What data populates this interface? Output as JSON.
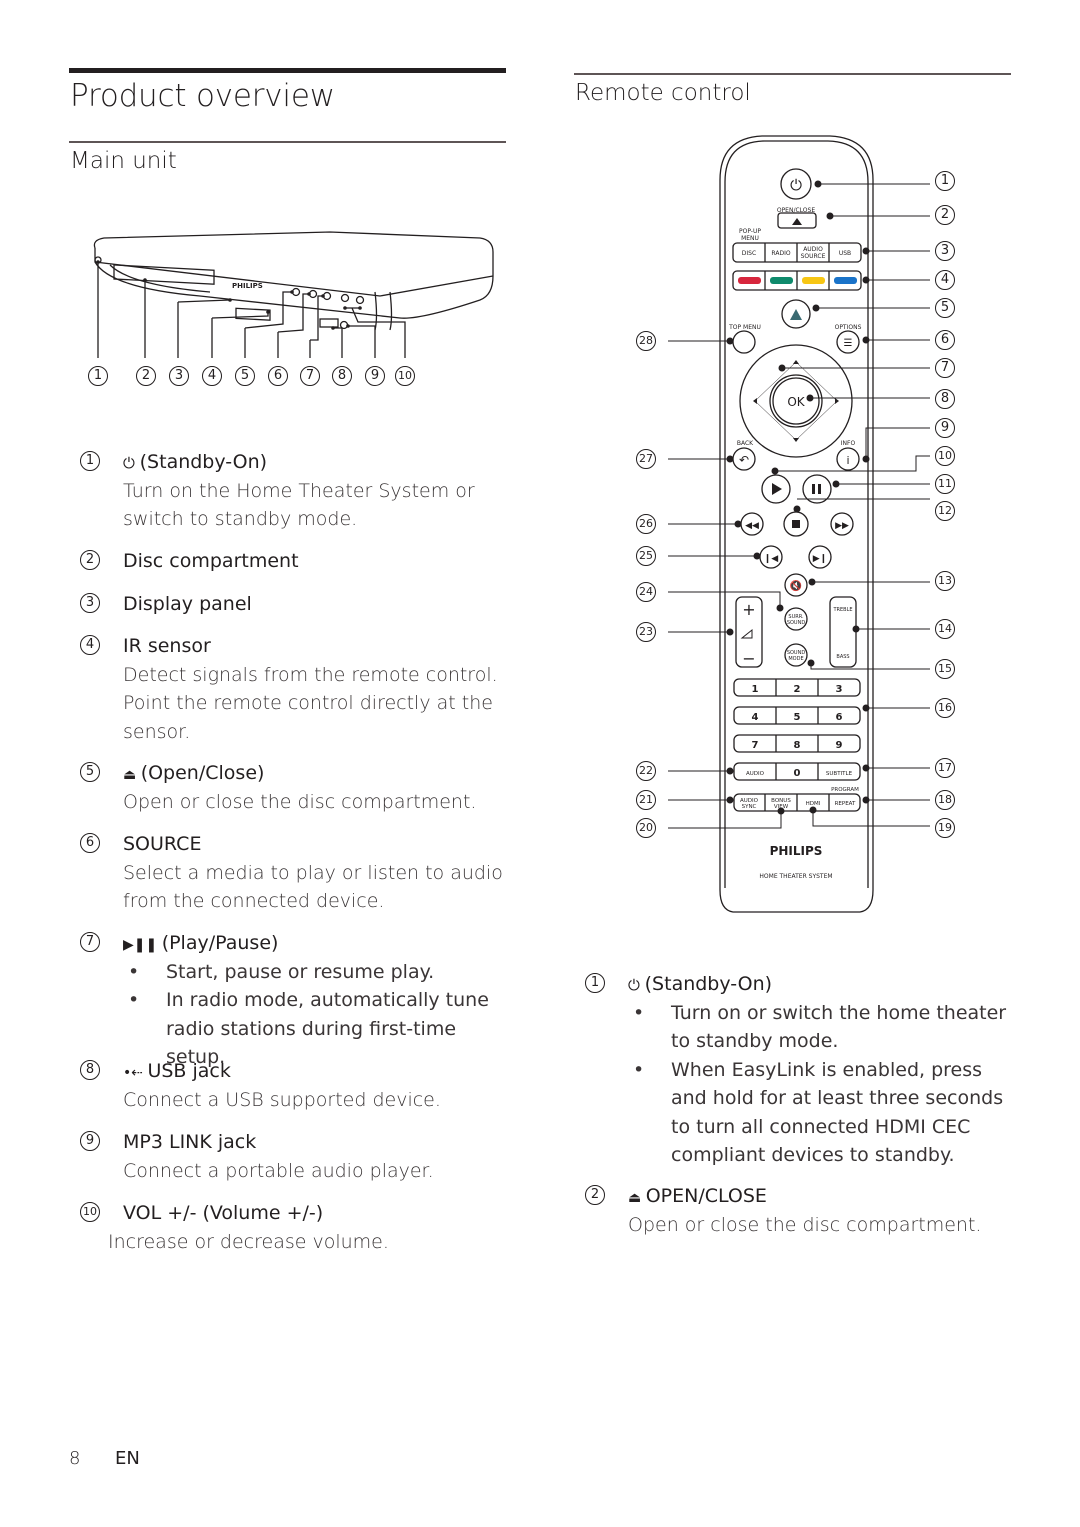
{
  "page": {
    "title": "Product overview",
    "page_number": "8",
    "language": "EN"
  },
  "main_unit": {
    "heading": "Main unit",
    "diagram": {
      "brand": "PHILIPS",
      "callouts": [
        "1",
        "2",
        "3",
        "4",
        "5",
        "6",
        "7",
        "8",
        "9",
        "10"
      ]
    },
    "items": [
      {
        "n": "1",
        "icon": "power-icon",
        "title": "(Standby-On)",
        "desc": "Turn on the Home Theater System or switch to standby mode."
      },
      {
        "n": "2",
        "title": "Disc compartment"
      },
      {
        "n": "3",
        "title": "Display panel"
      },
      {
        "n": "4",
        "title": "IR sensor",
        "desc": "Detect signals from the remote control. Point the remote control directly at the sensor."
      },
      {
        "n": "5",
        "icon": "eject-icon",
        "title": "(Open/Close)",
        "desc": "Open or close the disc compartment."
      },
      {
        "n": "6",
        "title": "SOURCE",
        "desc": "Select a media to play or listen to audio from the connected device."
      },
      {
        "n": "7",
        "icon": "play-pause-icon",
        "title": "(Play/Pause)",
        "bullets": [
          "Start, pause or resume play.",
          "In radio mode, automatically tune radio stations during first-time setup."
        ]
      },
      {
        "n": "8",
        "icon": "usb-icon",
        "title": "USB jack",
        "desc": "Connect a USB supported device."
      },
      {
        "n": "9",
        "title": "MP3 LINK jack",
        "desc": "Connect a portable audio player."
      },
      {
        "n": "10",
        "title": "VOL +/- (Volume +/-)",
        "desc": "Increase or decrease volume."
      }
    ]
  },
  "remote": {
    "heading": "Remote control",
    "labels": {
      "open_close": "OPEN/CLOSE",
      "popup_menu": "POP-UP MENU",
      "disc": "DISC",
      "radio": "RADIO",
      "audio_source_1": "AUDIO",
      "audio_source_2": "SOURCE",
      "usb": "USB",
      "top_menu": "TOP MENU",
      "options": "OPTIONS",
      "ok": "OK",
      "back": "BACK",
      "info": "INFO",
      "surr_sound_1": "SURR.",
      "surr_sound_2": "SOUND",
      "sound_mode_1": "SOUND",
      "sound_mode_2": "MODE",
      "treble": "TREBLE",
      "bass": "BASS",
      "digits": [
        "1",
        "2",
        "3",
        "4",
        "5",
        "6",
        "7",
        "8",
        "9",
        "0"
      ],
      "audio": "AUDIO",
      "subtitle": "SUBTITLE",
      "program": "PROGRAM",
      "audio_sync_1": "AUDIO",
      "audio_sync_2": "SYNC",
      "bonus_view_1": "BONUS",
      "bonus_view_2": "VIEW",
      "hdmi": "HDMI",
      "repeat": "REPEAT",
      "brand": "PHILIPS",
      "subtitle_brand": "HOME THEATER SYSTEM"
    },
    "color_keys": [
      "#d7263d",
      "#0f8a6c",
      "#f7c614",
      "#1a73c9"
    ],
    "right_callouts": [
      "1",
      "2",
      "3",
      "4",
      "5",
      "6",
      "7",
      "8",
      "9",
      "10",
      "11",
      "12",
      "13",
      "14",
      "15",
      "16",
      "17",
      "18",
      "19"
    ],
    "left_callouts": [
      "28",
      "27",
      "26",
      "25",
      "24",
      "23",
      "22",
      "21",
      "20"
    ],
    "items": [
      {
        "n": "1",
        "icon": "power-icon",
        "title": "(Standby-On)",
        "bullets": [
          "Turn on or switch the home theater to standby mode.",
          "When EasyLink is enabled, press and hold for at least three seconds to turn all connected HDMI CEC compliant devices to standby."
        ]
      },
      {
        "n": "2",
        "icon": "eject-icon",
        "title": "OPEN/CLOSE",
        "desc": "Open or close the disc compartment."
      }
    ]
  }
}
